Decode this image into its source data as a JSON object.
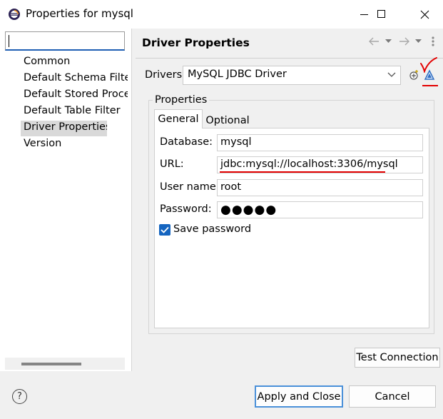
{
  "window": {
    "title": "Properties for mysql",
    "app_icon": "eclipse-icon",
    "controls": [
      "minimize-icon",
      "maximize-icon",
      "close-icon"
    ]
  },
  "sidebar": {
    "filter_value": "",
    "items": [
      {
        "label": "Common",
        "selected": false
      },
      {
        "label": "Default Schema Filte",
        "selected": false
      },
      {
        "label": "Default Stored Proce",
        "selected": false
      },
      {
        "label": "Default Table Filter",
        "selected": false
      },
      {
        "label": "Driver Properties",
        "selected": true
      },
      {
        "label": "Version",
        "selected": false
      }
    ]
  },
  "page": {
    "title": "Driver Properties",
    "nav_icons": [
      "back-arrow-icon",
      "back-menu-icon",
      "forward-arrow-icon",
      "forward-menu-icon",
      "more-icon"
    ]
  },
  "drivers": {
    "label": "Drivers:",
    "selected": "MySQL JDBC Driver",
    "icons": [
      "add-driver-icon",
      "edit-driver-icon"
    ]
  },
  "properties": {
    "group_label": "Properties",
    "tabs": [
      {
        "label": "General",
        "active": true
      },
      {
        "label": "Optional",
        "active": false
      }
    ],
    "fields": {
      "database": {
        "label": "Database:",
        "value": "mysql"
      },
      "url": {
        "label": "URL:",
        "value": "jdbc:mysql://localhost:3306/mysql"
      },
      "user": {
        "label": "User name:",
        "value": "root"
      },
      "password": {
        "label": "Password:",
        "value": "●●●●●"
      }
    },
    "save_password": {
      "label": "Save password",
      "checked": true
    }
  },
  "buttons": {
    "test_connection": "Test Connection",
    "apply_close": "Apply and Close",
    "cancel": "Cancel"
  },
  "colors": {
    "accent": "#1565c0",
    "annotation_red": "#e30000",
    "selection_bg": "#d9d9d9"
  }
}
